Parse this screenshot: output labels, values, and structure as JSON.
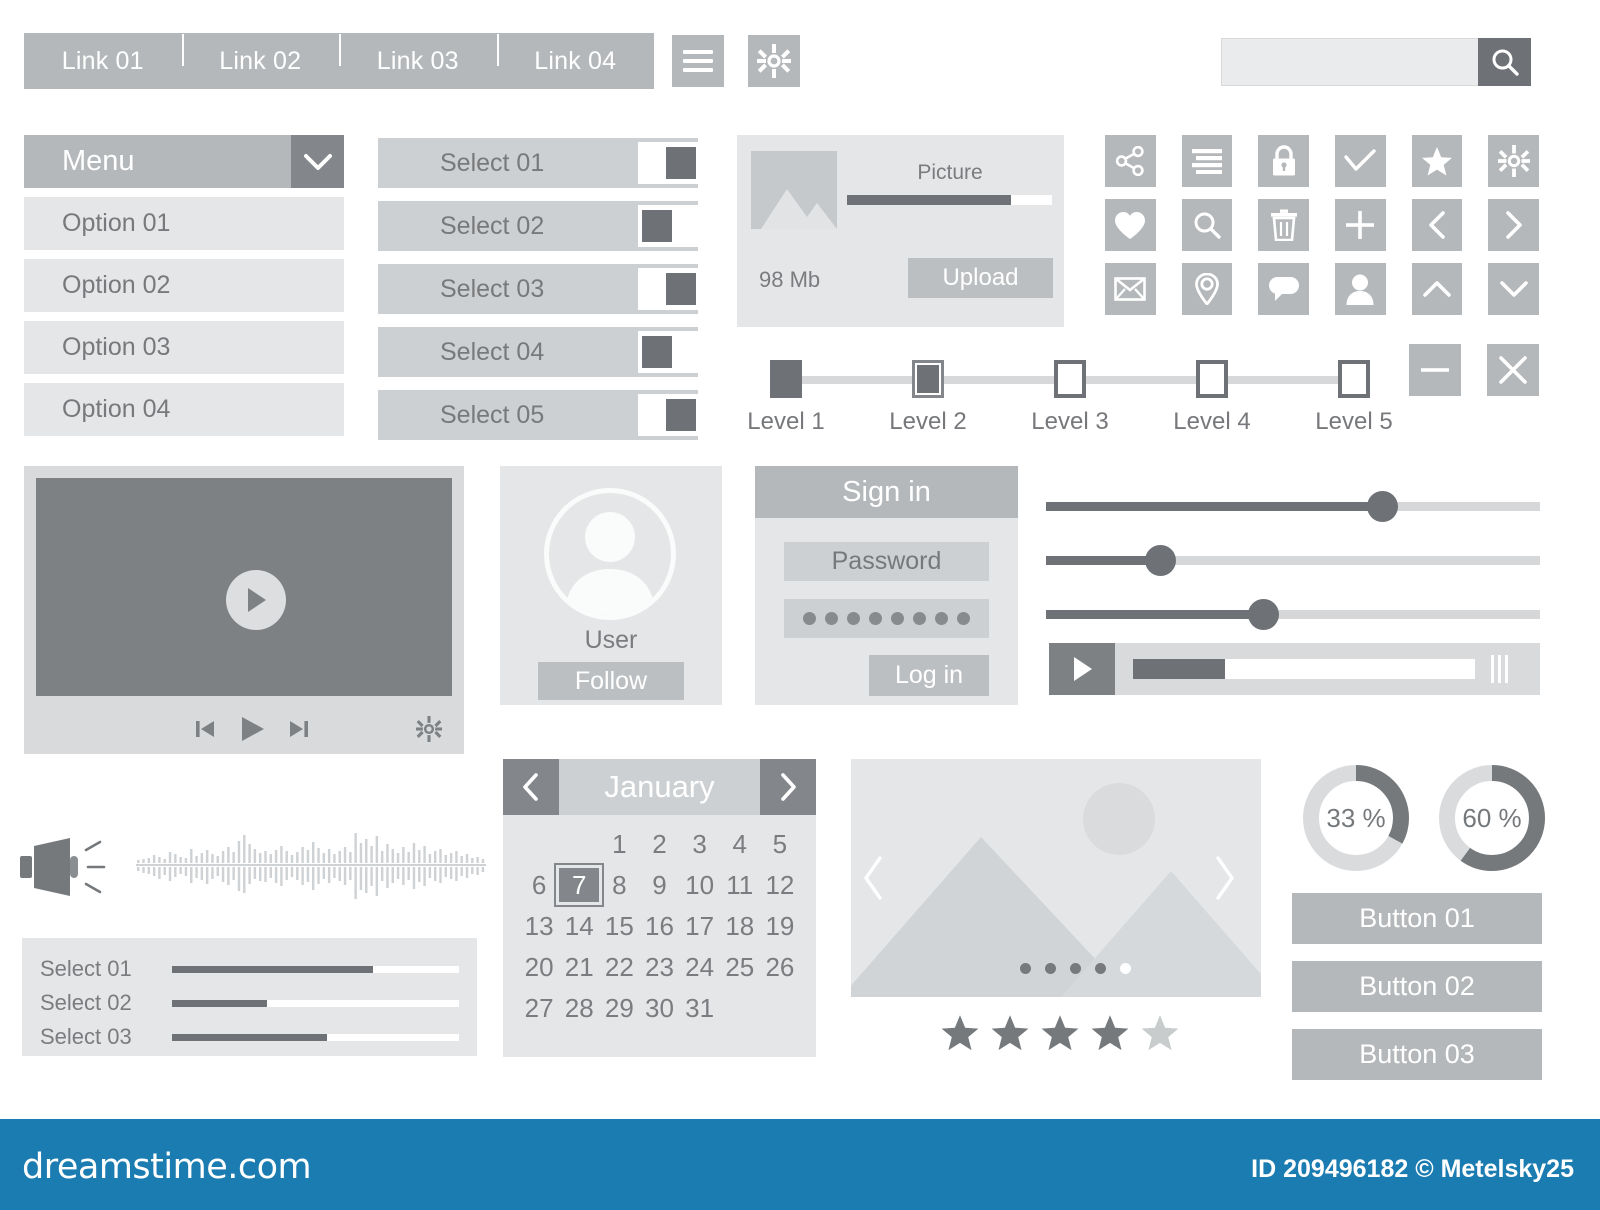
{
  "navbar": {
    "links": [
      "Link 01",
      "Link 02",
      "Link 03",
      "Link 04"
    ],
    "hamburger_icon": "hamburger-menu-icon",
    "gear_icon": "gear-icon"
  },
  "search": {
    "value": "",
    "placeholder": "",
    "button_icon": "search-icon"
  },
  "menu": {
    "title": "Menu",
    "toggle_icon": "chevron-down-icon",
    "options": [
      "Option 01",
      "Option 02",
      "Option 03",
      "Option 04"
    ]
  },
  "toggles": [
    {
      "label": "Select 01",
      "state": "on"
    },
    {
      "label": "Select 02",
      "state": "off"
    },
    {
      "label": "Select 03",
      "state": "on"
    },
    {
      "label": "Select 04",
      "state": "off"
    },
    {
      "label": "Select 05",
      "state": "on"
    }
  ],
  "upload": {
    "thumb_icon": "image-placeholder-icon",
    "title": "Picture",
    "progress_percent": 80,
    "size": "98 Mb",
    "button_label": "Upload"
  },
  "icon_grid": {
    "rows": [
      [
        "share-icon",
        "list-icon",
        "lock-icon",
        "check-icon",
        "star-icon",
        "gear-icon"
      ],
      [
        "heart-icon",
        "search-icon",
        "trash-icon",
        "plus-icon",
        "chevron-left-icon",
        "chevron-right-icon"
      ],
      [
        "mail-icon",
        "location-pin-icon",
        "chat-bubble-icon",
        "user-icon",
        "chevron-up-icon",
        "chevron-down-icon"
      ]
    ],
    "extra": [
      "minus-icon",
      "close-icon"
    ]
  },
  "stepper": {
    "labels": [
      "Level 1",
      "Level 2",
      "Level 3",
      "Level 4",
      "Level 5"
    ],
    "states": [
      "filled",
      "current",
      "empty",
      "empty",
      "empty"
    ],
    "current_level": 2
  },
  "video": {
    "play_overlay_icon": "play-icon",
    "controls": [
      "skip-previous-icon",
      "play-icon",
      "skip-next-icon",
      "gear-icon"
    ]
  },
  "user_card": {
    "avatar_icon": "user-avatar-icon",
    "name": "User",
    "follow_label": "Follow"
  },
  "signin": {
    "title": "Sign in",
    "password_label": "Password",
    "password_mask_length": 8,
    "login_label": "Log in"
  },
  "sliders": [
    {
      "percent": 68
    },
    {
      "percent": 23
    },
    {
      "percent": 44
    }
  ],
  "audio_player": {
    "play_icon": "play-icon",
    "progress_percent": 27,
    "end_icon": "pause-bars-icon"
  },
  "waveform": {
    "speaker_icon": "megaphone-icon",
    "bars_up": [
      3,
      4,
      5,
      8,
      6,
      4,
      11,
      9,
      6,
      5,
      14,
      7,
      10,
      13,
      9,
      7,
      12,
      16,
      11,
      22,
      28,
      19,
      14,
      10,
      12,
      9,
      13,
      17,
      12,
      8,
      11,
      16,
      13,
      21,
      15,
      10,
      14,
      9,
      12,
      16,
      11,
      30,
      20,
      24,
      17,
      27,
      12,
      19,
      14,
      10,
      16,
      11,
      20,
      13,
      17,
      9,
      12,
      14,
      8,
      10,
      12,
      7,
      9,
      5,
      6,
      4
    ],
    "bars_down": [
      4,
      6,
      7,
      9,
      12,
      8,
      14,
      10,
      7,
      9,
      16,
      11,
      13,
      17,
      12,
      9,
      15,
      18,
      13,
      24,
      26,
      17,
      12,
      14,
      15,
      11,
      16,
      19,
      13,
      10,
      13,
      18,
      15,
      23,
      17,
      12,
      16,
      11,
      14,
      18,
      13,
      32,
      23,
      26,
      19,
      29,
      14,
      21,
      16,
      12,
      18,
      13,
      22,
      15,
      19,
      11,
      14,
      16,
      10,
      12,
      14,
      9,
      11,
      7,
      8,
      5
    ]
  },
  "progress_list": [
    {
      "label": "Select 01",
      "percent": 70
    },
    {
      "label": "Select 02",
      "percent": 33
    },
    {
      "label": "Select 03",
      "percent": 54
    }
  ],
  "calendar": {
    "month": "January",
    "prev_icon": "chevron-left-icon",
    "next_icon": "chevron-right-icon",
    "leading_blanks": 2,
    "days": [
      1,
      2,
      3,
      4,
      5,
      6,
      7,
      8,
      9,
      10,
      11,
      12,
      13,
      14,
      15,
      16,
      17,
      18,
      19,
      20,
      21,
      22,
      23,
      24,
      25,
      26,
      27,
      28,
      29,
      30,
      31
    ],
    "selected_day": 7
  },
  "carousel": {
    "image_icon": "mountain-landscape-icon",
    "prev_icon": "chevron-left-icon",
    "next_icon": "chevron-right-icon",
    "dots": 5,
    "active_dot_index": 4,
    "stars_total": 5,
    "stars_filled": 4
  },
  "donuts": [
    {
      "label": "33 %",
      "percent": 33
    },
    {
      "label": "60 %",
      "percent": 60
    }
  ],
  "buttons": [
    "Button 01",
    "Button 02",
    "Button 03"
  ],
  "footer": {
    "logo": "dreamstime.com",
    "credit": "ID 209496182 © Metelsky25"
  },
  "colors": {
    "chrome": "#b5b8ba",
    "panel": "#e4e6e7",
    "dark": "#6e7175",
    "track": "#d5d7d9",
    "footer": "#1a7cb0"
  }
}
